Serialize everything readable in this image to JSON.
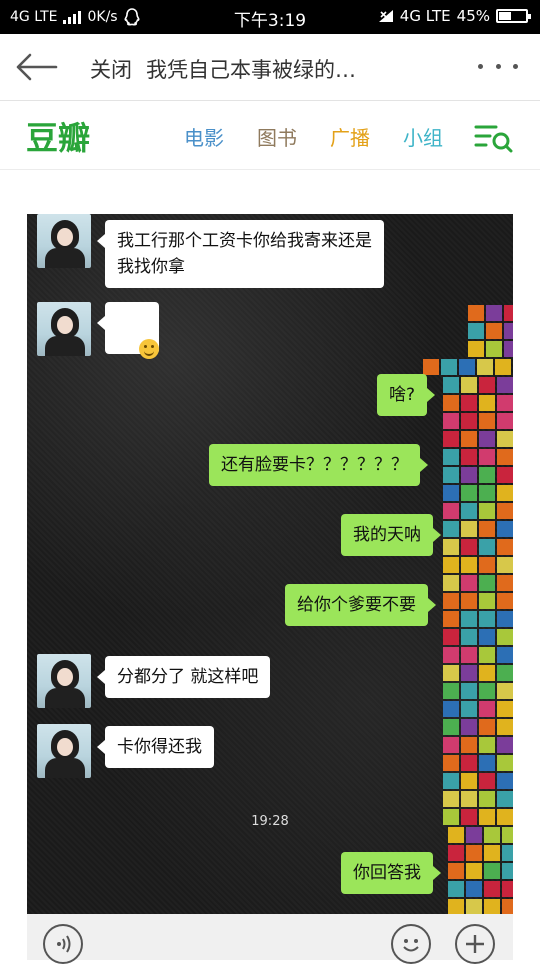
{
  "status_bar": {
    "network_left": "4G LTE",
    "speed": "0K/s",
    "time": "下午3:19",
    "network_right": "4G LTE",
    "battery": "45%",
    "battery_level": 0.45
  },
  "title_bar": {
    "close_label": "关闭",
    "title": "我凭自己本事被绿的…"
  },
  "site_nav": {
    "logo": "豆瓣",
    "links": [
      {
        "label": "电影",
        "color": "#4a90c9"
      },
      {
        "label": "图书",
        "color": "#8f7a5d"
      },
      {
        "label": "广播",
        "color": "#e3a118"
      },
      {
        "label": "小组",
        "color": "#3fb4c8"
      }
    ],
    "accent": "#2aa53a"
  },
  "chat": {
    "messages": [
      {
        "side": "in",
        "text": "我工行那个工资卡你给我寄来还是\n我找你拿"
      },
      {
        "side": "in",
        "text": "smile-emoji"
      },
      {
        "side": "out",
        "text": "啥?"
      },
      {
        "side": "out",
        "text": "还有脸要卡？？？？？？"
      },
      {
        "side": "out",
        "text": "我的天呐"
      },
      {
        "side": "out",
        "text": "给你个爹要不要"
      },
      {
        "side": "in",
        "text": "分都分了 就这样吧"
      },
      {
        "side": "in",
        "text": "卡你得还我"
      },
      {
        "side": "out",
        "text": "你回答我"
      }
    ],
    "timestamp": "19:28",
    "bubble_out_color": "#9be55a",
    "bubble_in_color": "#ffffff"
  }
}
